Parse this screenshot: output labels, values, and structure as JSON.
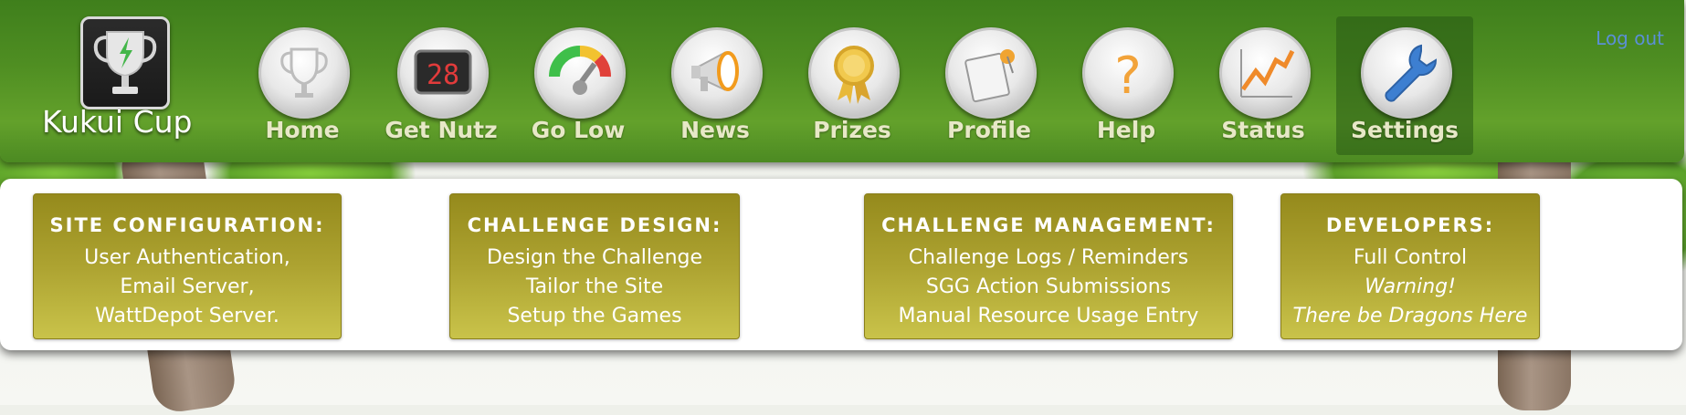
{
  "brand": {
    "name": "Kukui Cup"
  },
  "nav": [
    {
      "label": "Home",
      "icon": "trophy-icon"
    },
    {
      "label": "Get Nutz",
      "icon": "scoreboard-icon",
      "badge": "28"
    },
    {
      "label": "Go Low",
      "icon": "gauge-icon"
    },
    {
      "label": "News",
      "icon": "megaphone-icon"
    },
    {
      "label": "Prizes",
      "icon": "ribbon-icon"
    },
    {
      "label": "Profile",
      "icon": "id-card-icon"
    },
    {
      "label": "Help",
      "icon": "question-icon"
    },
    {
      "label": "Status",
      "icon": "trend-chart-icon"
    },
    {
      "label": "Settings",
      "icon": "wrench-icon",
      "active": true
    }
  ],
  "logout": "Log out",
  "cards": [
    {
      "title": "SITE CONFIGURATION:",
      "lines": [
        "User Authentication,",
        "Email Server,",
        "WattDepot Server."
      ]
    },
    {
      "title": "CHALLENGE DESIGN:",
      "lines": [
        "Design the Challenge",
        "Tailor the Site",
        "Setup the Games"
      ]
    },
    {
      "title": "CHALLENGE MANAGEMENT:",
      "lines": [
        "Challenge Logs / Reminders",
        "SGG Action Submissions",
        "Manual Resource Usage Entry"
      ]
    },
    {
      "title": "DEVELOPERS:",
      "lines": [
        "Full Control",
        "Warning!",
        "There be Dragons Here"
      ]
    }
  ],
  "colors": {
    "header_green": "#4f8e22",
    "nav_label": "#e7e8c7",
    "card_olive": "#ada331",
    "logout_link": "#5b8fd6"
  }
}
